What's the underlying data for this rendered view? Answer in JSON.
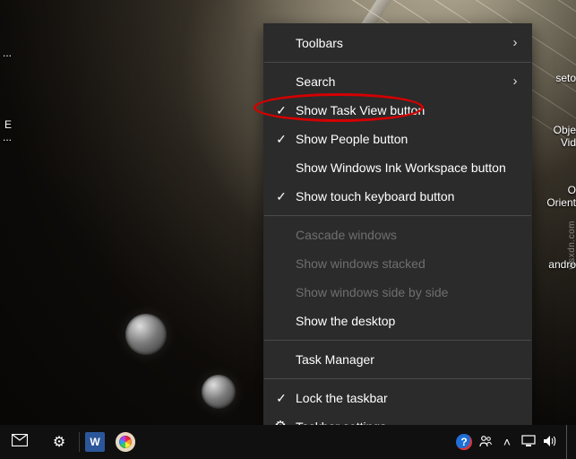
{
  "desktop_labels": {
    "left1": "...",
    "left2": "E\n...",
    "right1": "seto",
    "right2": "Obje\nVid",
    "right3": "O\nOrient",
    "right4": "andro"
  },
  "menu": {
    "toolbars": {
      "label": "Toolbars",
      "submenu": true
    },
    "search": {
      "label": "Search",
      "submenu": true
    },
    "show_task_view": {
      "label": "Show Task View button",
      "checked": true
    },
    "show_people": {
      "label": "Show People button",
      "checked": true
    },
    "show_ink": {
      "label": "Show Windows Ink Workspace button",
      "checked": false
    },
    "show_touch_kb": {
      "label": "Show touch keyboard button",
      "checked": true
    },
    "cascade": {
      "label": "Cascade windows",
      "disabled": true
    },
    "stacked": {
      "label": "Show windows stacked",
      "disabled": true
    },
    "sidebyside": {
      "label": "Show windows side by side",
      "disabled": true
    },
    "show_desktop": {
      "label": "Show the desktop"
    },
    "task_manager": {
      "label": "Task Manager"
    },
    "lock_taskbar": {
      "label": "Lock the taskbar",
      "checked": true
    },
    "taskbar_settings": {
      "label": "Taskbar settings",
      "icon": "gear"
    }
  },
  "taskbar": {
    "word_letter": "W"
  },
  "watermark": "wsxdn.com"
}
